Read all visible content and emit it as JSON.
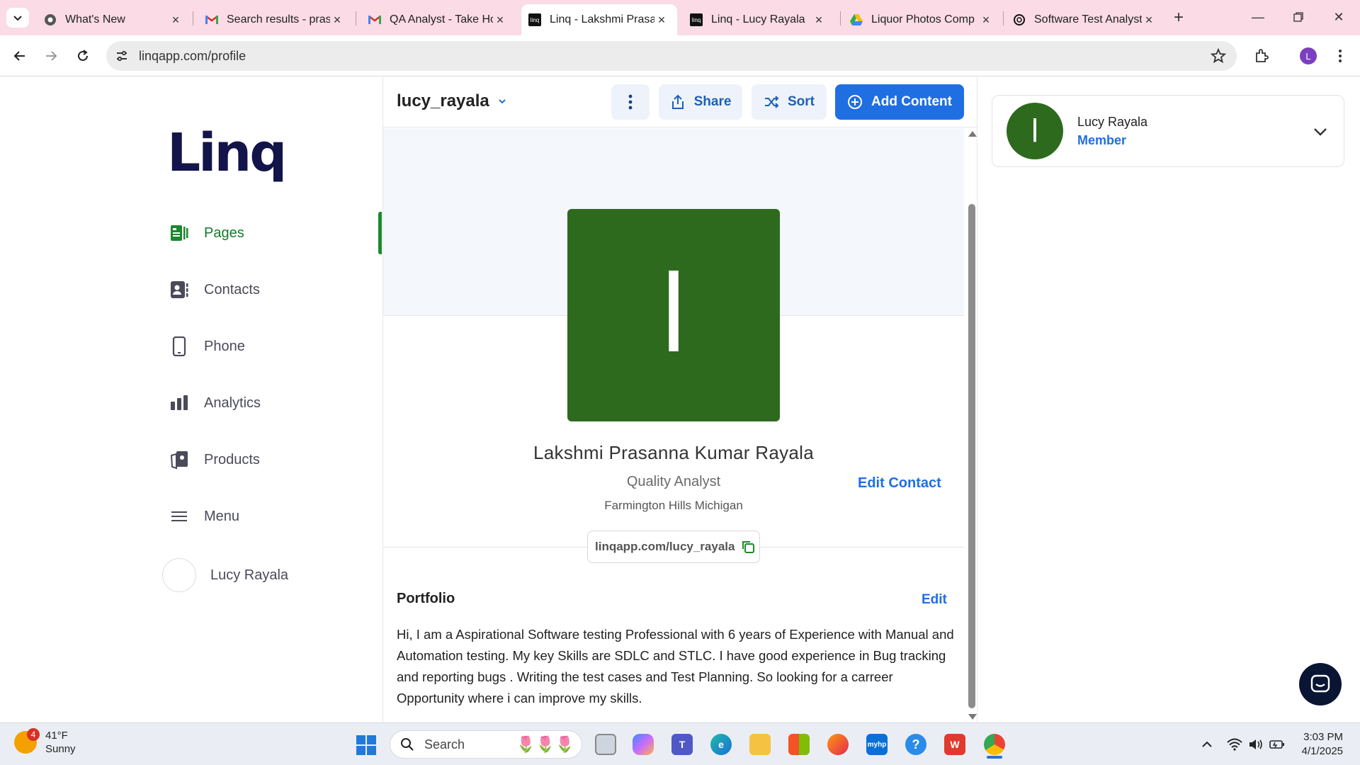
{
  "browser": {
    "tabs": [
      {
        "title": "What's New",
        "icon": "chrome-settings-icon"
      },
      {
        "title": "Search results - prasa",
        "icon": "gmail-icon"
      },
      {
        "title": "QA Analyst - Take Ho",
        "icon": "gmail-icon"
      },
      {
        "title": "Linq - Lakshmi Prasan",
        "icon": "linq-icon",
        "active": true
      },
      {
        "title": "Linq - Lucy Rayala",
        "icon": "linq-icon"
      },
      {
        "title": "Liquor Photos Comp",
        "icon": "google-drive-icon"
      },
      {
        "title": "Software Test Analyst",
        "icon": "openai-icon"
      }
    ],
    "url": "linqapp.com/profile",
    "profile_initial": "L"
  },
  "sidebar": {
    "logo": "Linq",
    "items": [
      {
        "label": "Pages",
        "icon": "pages-icon",
        "active": true
      },
      {
        "label": "Contacts",
        "icon": "contacts-icon"
      },
      {
        "label": "Phone",
        "icon": "phone-icon"
      },
      {
        "label": "Analytics",
        "icon": "analytics-icon"
      },
      {
        "label": "Products",
        "icon": "products-icon"
      },
      {
        "label": "Menu",
        "icon": "menu-icon"
      }
    ],
    "user_name": "Lucy Rayala"
  },
  "header": {
    "username": "lucy_rayala",
    "share_label": "Share",
    "sort_label": "Sort",
    "add_content_label": "Add Content"
  },
  "profile": {
    "avatar_initial": "l",
    "full_name": "Lakshmi Prasanna Kumar Rayala",
    "job_title": "Quality Analyst",
    "location": "Farmington Hills Michigan",
    "edit_contact_label": "Edit Contact",
    "profile_url": "linqapp.com/lucy_rayala"
  },
  "portfolio": {
    "title": "Portfolio",
    "edit_label": "Edit",
    "text": "Hi, I am a Aspirational Software testing Professional with 6 years of Experience with Manual and Automation testing. My key Skills are SDLC and STLC. I have good experience in Bug tracking and reporting bugs . Writing the test cases and Test Planning. So looking for a carreer Opportunity where i can improve my skills."
  },
  "account_card": {
    "avatar_initial": "l",
    "name": "Lucy Rayala",
    "role": "Member"
  },
  "taskbar": {
    "weather_badge": "4",
    "temperature": "41°F",
    "condition": "Sunny",
    "search_placeholder": "Search",
    "time": "3:03 PM",
    "date": "4/1/2025"
  },
  "colors": {
    "brand_green": "#2e6a1e",
    "accent_blue": "#1f6fe3",
    "active_nav_green": "#167a2a",
    "tab_strip_pink": "#fadbe6"
  }
}
